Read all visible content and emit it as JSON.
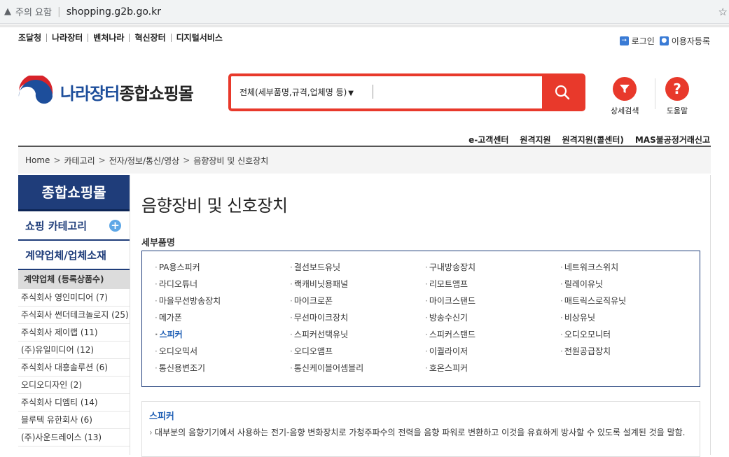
{
  "browser": {
    "warning_icon": "warning-triangle-icon",
    "warning_text": "주의 요함",
    "url": "shopping.g2b.go.kr"
  },
  "utility": {
    "sites": [
      "조달청",
      "나라장터",
      "벤처나라",
      "혁신장터",
      "디지털서비스"
    ],
    "login": "로그인",
    "register": "이용자등록"
  },
  "header": {
    "logo_text_blue": "나라장터",
    "logo_text_black": "종합쇼핑몰",
    "search_scope": "전체(세부품명,규격,업체명 등)",
    "search_value": "",
    "tools": [
      {
        "icon": "filter-icon",
        "label": "상세검색"
      },
      {
        "icon": "help-icon",
        "label": "도움말"
      }
    ],
    "service_links": [
      "e-고객센터",
      "원격지원",
      "원격지원(콜센터)",
      "MAS불공정거래신고"
    ]
  },
  "breadcrumb": [
    "Home",
    "카테고리",
    "전자/정보/통신/영상",
    "음향장비 및 신호장치"
  ],
  "sidebar": {
    "title": "종합쇼핑몰",
    "menus": [
      "쇼핑 카테고리",
      "계약업체/업체소재"
    ],
    "vendor_header": "계약업체 (등록상품수)",
    "vendors": [
      "주식회사 영인미디어 (7)",
      "주식회사 썬더테크놀로지 (25)",
      "주식회사 제이랩 (11)",
      "(주)유일미디어 (12)",
      "주식회사 대흥솔루션 (6)",
      "오디오디자인 (2)",
      "주식회사 디엠티 (14)",
      "블루텍 유한회사 (6)",
      "(주)사운드레이스 (13)"
    ]
  },
  "main": {
    "title": "음향장비 및 신호장치",
    "section_title": "세부품명",
    "items": [
      "PA용스피커",
      "결선보드유닛",
      "구내방송장치",
      "네트워크스위치",
      "라디오튜너",
      "랙캐비닛용패널",
      "리모트앰프",
      "릴레이유닛",
      "마을무선방송장치",
      "마이크로폰",
      "마이크스탠드",
      "매트릭스로직유닛",
      "메가폰",
      "무선마이크장치",
      "방송수신기",
      "비상유닛",
      "스피커",
      "스피커선택유닛",
      "스피커스탠드",
      "오디오모니터",
      "오디오믹서",
      "오디오앰프",
      "이퀄라이저",
      "전원공급장치",
      "통신용변조기",
      "통신케이블어셈블리",
      "호온스피커"
    ],
    "active_item": "스피커",
    "desc_title": "스피커",
    "desc_text": "대부분의 음향기기에서 사용하는 전기-음향 변화장치로 가청주파수의 전력을 음향 파워로 변환하고 이것을 유효하게 방사할 수 있도록 설계된 것을 말함."
  },
  "colors": {
    "brand_navy": "#1f3d7a",
    "accent_red": "#e8392b",
    "link_blue": "#1f5fb5"
  }
}
